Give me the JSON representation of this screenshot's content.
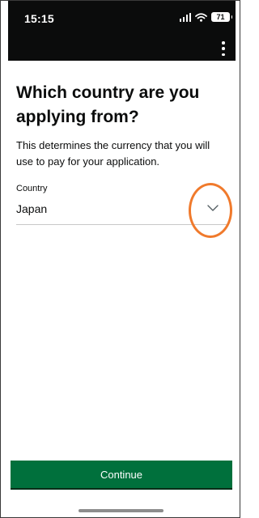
{
  "status_bar": {
    "time": "15:15",
    "battery": "71",
    "icons": [
      "signal-icon",
      "wifi-icon",
      "battery-icon"
    ]
  },
  "header": {
    "menu_icon": "kebab-menu-icon"
  },
  "page": {
    "title": "Which country are you applying from?",
    "description": "This determines the currency that you will use to pay for your application."
  },
  "country_field": {
    "label": "Country",
    "value": "Japan",
    "icon": "chevron-down-icon"
  },
  "continue_button": {
    "label": "Continue"
  },
  "colors": {
    "accent_green": "#00703c",
    "highlight_orange": "#f07a2c",
    "topbar": "#0b0c0c"
  }
}
